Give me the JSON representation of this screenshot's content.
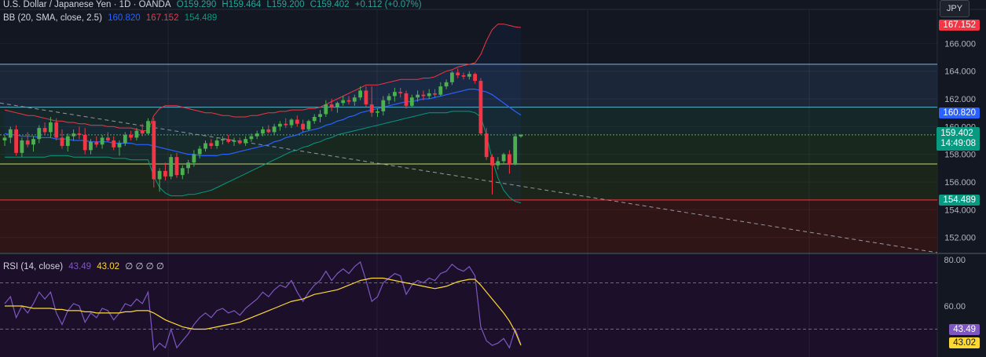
{
  "header": {
    "symbol": "U.S. Dollar / Japanese Yen · 1D · OANDA",
    "open": "O159.290",
    "high": "H159.464",
    "low": "L159.200",
    "close": "C159.402",
    "change": "+0.112 (+0.07%)"
  },
  "bb_legend": {
    "label": "BB (20, SMA, close, 2.5)",
    "basis": "160.820",
    "upper": "167.152",
    "lower": "154.489"
  },
  "rsi_legend": {
    "label": "RSI (14, close)",
    "rsi": "43.49",
    "ma": "43.02",
    "extras": "∅ ∅ ∅ ∅"
  },
  "currency_button": "JPY",
  "price_badges": {
    "upper": "167.152",
    "basis": "160.820",
    "last": "159.402",
    "countdown": "14:49:08",
    "lower": "154.489",
    "rsi": "43.49",
    "rsi_ma": "43.02"
  },
  "colors": {
    "background": "#131722",
    "up": "#26a69a",
    "candle_up": "#4caf50",
    "candle_down": "#f23645",
    "bb_upper": "#f23645",
    "bb_basis": "#2962ff",
    "bb_lower": "#089981",
    "rsi": "#7e57c2",
    "rsi_ma": "#fdd835"
  },
  "chart_data": [
    {
      "type": "candlestick",
      "title": "U.S. Dollar / Japanese Yen",
      "ylim": [
        150.9,
        168.4
      ],
      "y_ticks": [
        "166.000",
        "164.000",
        "162.000",
        "160.000",
        "158.000",
        "156.000",
        "154.000",
        "152.000"
      ],
      "horizontal_levels": [
        164.5,
        161.4,
        159.4,
        157.3,
        154.7
      ],
      "candles": [
        [
          159.0,
          159.4,
          158.6,
          159.2
        ],
        [
          159.2,
          160.0,
          158.8,
          159.8
        ],
        [
          159.8,
          160.1,
          157.9,
          158.1
        ],
        [
          158.1,
          159.2,
          157.8,
          159.0
        ],
        [
          159.0,
          159.6,
          158.5,
          158.7
        ],
        [
          158.7,
          159.3,
          158.2,
          159.1
        ],
        [
          159.1,
          160.1,
          158.8,
          159.9
        ],
        [
          159.9,
          160.3,
          159.4,
          159.6
        ],
        [
          159.6,
          160.7,
          159.2,
          160.3
        ],
        [
          160.3,
          160.6,
          159.0,
          159.2
        ],
        [
          159.2,
          159.8,
          158.4,
          158.6
        ],
        [
          158.6,
          159.5,
          158.2,
          159.3
        ],
        [
          159.3,
          159.8,
          159.0,
          159.5
        ],
        [
          159.5,
          160.0,
          159.1,
          159.4
        ],
        [
          159.4,
          159.9,
          158.0,
          158.3
        ],
        [
          158.3,
          159.1,
          158.0,
          158.9
        ],
        [
          158.9,
          159.3,
          158.5,
          158.7
        ],
        [
          158.7,
          159.4,
          158.4,
          159.2
        ],
        [
          159.2,
          159.6,
          158.9,
          159.0
        ],
        [
          159.0,
          159.3,
          158.3,
          158.5
        ],
        [
          158.5,
          159.0,
          157.9,
          158.8
        ],
        [
          158.8,
          159.6,
          158.6,
          159.4
        ],
        [
          159.4,
          159.7,
          159.0,
          159.2
        ],
        [
          159.2,
          159.9,
          159.0,
          159.7
        ],
        [
          159.7,
          160.2,
          159.3,
          159.5
        ],
        [
          159.5,
          160.6,
          159.4,
          160.4
        ],
        [
          160.4,
          160.6,
          155.6,
          156.2
        ],
        [
          156.2,
          157.0,
          155.3,
          156.8
        ],
        [
          156.8,
          157.4,
          156.1,
          156.4
        ],
        [
          156.4,
          158.0,
          156.2,
          157.8
        ],
        [
          157.8,
          158.1,
          156.3,
          156.5
        ],
        [
          156.5,
          157.2,
          156.2,
          157.0
        ],
        [
          157.0,
          157.6,
          156.6,
          157.4
        ],
        [
          157.4,
          158.3,
          157.1,
          158.0
        ],
        [
          158.0,
          158.6,
          157.7,
          158.4
        ],
        [
          158.4,
          159.0,
          158.2,
          158.8
        ],
        [
          158.8,
          159.1,
          158.4,
          158.6
        ],
        [
          158.6,
          159.2,
          158.4,
          159.0
        ],
        [
          159.0,
          159.3,
          158.7,
          159.1
        ],
        [
          159.1,
          159.4,
          158.8,
          158.9
        ],
        [
          158.9,
          159.2,
          158.6,
          159.0
        ],
        [
          159.0,
          159.2,
          158.7,
          158.8
        ],
        [
          158.8,
          159.3,
          158.6,
          159.1
        ],
        [
          159.1,
          159.5,
          158.9,
          159.3
        ],
        [
          159.3,
          159.7,
          159.1,
          159.5
        ],
        [
          159.5,
          160.0,
          159.3,
          159.8
        ],
        [
          159.8,
          160.1,
          159.5,
          159.6
        ],
        [
          159.6,
          160.2,
          159.4,
          160.0
        ],
        [
          160.0,
          160.4,
          159.7,
          160.2
        ],
        [
          160.2,
          160.6,
          159.9,
          160.1
        ],
        [
          160.1,
          160.6,
          159.9,
          160.5
        ],
        [
          160.5,
          160.8,
          160.0,
          160.2
        ],
        [
          160.2,
          160.5,
          159.6,
          159.8
        ],
        [
          159.8,
          160.5,
          159.7,
          160.4
        ],
        [
          160.4,
          160.9,
          160.2,
          160.7
        ],
        [
          160.7,
          161.2,
          160.3,
          160.9
        ],
        [
          160.9,
          161.9,
          160.7,
          161.6
        ],
        [
          161.6,
          162.0,
          161.1,
          161.4
        ],
        [
          161.4,
          161.8,
          161.0,
          161.7
        ],
        [
          161.7,
          162.2,
          161.5,
          161.9
        ],
        [
          161.9,
          162.2,
          161.6,
          161.8
        ],
        [
          161.8,
          162.3,
          161.5,
          162.1
        ],
        [
          162.1,
          162.9,
          161.9,
          162.6
        ],
        [
          162.6,
          162.9,
          161.4,
          161.6
        ],
        [
          161.6,
          162.9,
          160.7,
          161.0
        ],
        [
          161.0,
          161.3,
          160.7,
          161.1
        ],
        [
          161.1,
          162.2,
          160.8,
          161.9
        ],
        [
          161.9,
          162.4,
          161.6,
          162.2
        ],
        [
          162.2,
          162.8,
          161.8,
          162.5
        ],
        [
          162.5,
          162.8,
          162.1,
          162.4
        ],
        [
          162.4,
          162.6,
          161.3,
          161.5
        ],
        [
          161.5,
          162.3,
          161.4,
          162.1
        ],
        [
          162.1,
          162.6,
          161.8,
          162.3
        ],
        [
          162.3,
          162.6,
          161.9,
          162.2
        ],
        [
          162.2,
          162.7,
          162.0,
          162.4
        ],
        [
          162.4,
          162.7,
          162.1,
          162.3
        ],
        [
          162.3,
          163.2,
          162.2,
          162.9
        ],
        [
          162.9,
          163.4,
          162.7,
          163.2
        ],
        [
          163.2,
          164.0,
          163.0,
          163.9
        ],
        [
          163.9,
          164.2,
          163.5,
          163.7
        ],
        [
          163.7,
          163.9,
          163.4,
          163.6
        ],
        [
          163.6,
          164.0,
          163.4,
          163.8
        ],
        [
          163.8,
          163.9,
          163.1,
          163.3
        ],
        [
          163.3,
          163.5,
          159.4,
          159.5
        ],
        [
          159.5,
          159.9,
          157.6,
          157.8
        ],
        [
          157.8,
          158.0,
          155.1,
          157.2
        ],
        [
          157.2,
          157.8,
          156.9,
          157.5
        ],
        [
          157.5,
          158.1,
          157.3,
          158.0
        ],
        [
          158.0,
          158.3,
          156.6,
          157.3
        ],
        [
          157.3,
          159.5,
          157.2,
          159.3
        ],
        [
          159.29,
          159.464,
          159.2,
          159.402
        ]
      ],
      "bb_upper": [
        161.2,
        161.1,
        161.0,
        160.9,
        160.8,
        160.8,
        160.7,
        160.6,
        160.5,
        160.4,
        160.4,
        160.3,
        160.3,
        160.2,
        160.2,
        160.1,
        160.1,
        160.1,
        160.0,
        160.0,
        159.9,
        159.9,
        159.9,
        159.8,
        159.7,
        159.7,
        160.8,
        161.3,
        161.5,
        161.5,
        161.5,
        161.4,
        161.3,
        161.2,
        161.1,
        161.0,
        161.0,
        160.9,
        160.8,
        160.8,
        160.7,
        160.7,
        160.7,
        160.8,
        160.8,
        160.9,
        161.0,
        161.0,
        161.1,
        161.1,
        161.2,
        161.2,
        161.2,
        161.3,
        161.3,
        161.4,
        161.6,
        161.8,
        162.0,
        162.2,
        162.4,
        162.6,
        162.8,
        163.0,
        163.0,
        163.0,
        163.1,
        163.2,
        163.3,
        163.4,
        163.4,
        163.4,
        163.4,
        163.5,
        163.5,
        163.6,
        163.8,
        164.0,
        164.1,
        164.3,
        164.4,
        164.5,
        164.6,
        165.2,
        166.2,
        167.0,
        167.4,
        167.4,
        167.3,
        167.2,
        167.152
      ],
      "bb_basis": [
        159.5,
        159.4,
        159.4,
        159.3,
        159.3,
        159.3,
        159.2,
        159.2,
        159.2,
        159.1,
        159.1,
        159.1,
        159.0,
        159.0,
        159.0,
        158.9,
        158.9,
        158.9,
        158.9,
        158.8,
        158.8,
        158.8,
        158.8,
        158.7,
        158.7,
        158.7,
        158.6,
        158.5,
        158.4,
        158.3,
        158.2,
        158.1,
        158.0,
        158.0,
        157.9,
        157.9,
        157.9,
        157.9,
        158.0,
        158.0,
        158.1,
        158.2,
        158.3,
        158.4,
        158.5,
        158.6,
        158.7,
        158.9,
        159.0,
        159.2,
        159.3,
        159.4,
        159.6,
        159.7,
        159.8,
        159.9,
        160.1,
        160.2,
        160.4,
        160.5,
        160.7,
        160.8,
        161.0,
        161.1,
        161.2,
        161.3,
        161.4,
        161.5,
        161.6,
        161.7,
        161.8,
        161.8,
        161.9,
        162.0,
        162.0,
        162.1,
        162.2,
        162.3,
        162.4,
        162.5,
        162.6,
        162.7,
        162.7,
        162.6,
        162.5,
        162.3,
        162.0,
        161.7,
        161.4,
        161.1,
        160.82
      ],
      "bb_lower": [
        157.8,
        157.8,
        157.8,
        157.8,
        157.8,
        157.8,
        157.8,
        157.8,
        157.9,
        157.9,
        157.9,
        157.9,
        157.8,
        157.8,
        157.8,
        157.8,
        157.8,
        157.8,
        157.8,
        157.7,
        157.7,
        157.7,
        157.6,
        157.6,
        157.6,
        157.6,
        156.4,
        155.6,
        155.2,
        155.0,
        155.0,
        155.0,
        155.1,
        155.1,
        155.2,
        155.3,
        155.4,
        155.6,
        155.8,
        156.0,
        156.2,
        156.4,
        156.6,
        156.8,
        157.0,
        157.2,
        157.4,
        157.6,
        157.8,
        158.0,
        158.2,
        158.3,
        158.5,
        158.6,
        158.8,
        158.9,
        159.1,
        159.2,
        159.4,
        159.5,
        159.6,
        159.7,
        159.8,
        159.9,
        160.0,
        160.1,
        160.2,
        160.3,
        160.4,
        160.5,
        160.6,
        160.7,
        160.8,
        160.9,
        161.0,
        161.0,
        161.0,
        161.0,
        161.1,
        161.1,
        161.1,
        161.1,
        161.0,
        160.7,
        159.4,
        157.6,
        156.3,
        155.4,
        154.9,
        154.6,
        154.489
      ]
    },
    {
      "type": "line",
      "title": "RSI (14, close)",
      "ylim": [
        38,
        82
      ],
      "y_ticks": [
        "80.00",
        "60.00"
      ],
      "levels": [
        70,
        50
      ],
      "series": [
        {
          "name": "RSI",
          "values": [
            61,
            64,
            55,
            60,
            57,
            61,
            66,
            63,
            66,
            57,
            52,
            58,
            61,
            60,
            53,
            57,
            55,
            59,
            58,
            54,
            57,
            61,
            60,
            63,
            61,
            66,
            41,
            44,
            42,
            50,
            42,
            45,
            48,
            52,
            55,
            57,
            55,
            58,
            59,
            57,
            58,
            56,
            59,
            61,
            63,
            66,
            64,
            67,
            69,
            68,
            71,
            66,
            62,
            66,
            69,
            71,
            75,
            71,
            74,
            76,
            74,
            77,
            79,
            71,
            62,
            64,
            70,
            72,
            74,
            73,
            65,
            69,
            71,
            70,
            72,
            71,
            74,
            75,
            78,
            76,
            75,
            77,
            73,
            51,
            45,
            43,
            44,
            46,
            42,
            50,
            43.49
          ]
        },
        {
          "name": "RSI MA",
          "values": [
            60,
            60,
            60,
            60,
            59.5,
            59,
            59,
            59,
            59,
            58.5,
            58.5,
            58,
            58,
            58,
            57.5,
            57.5,
            57,
            57,
            57,
            57,
            57,
            57.5,
            57.5,
            58,
            58,
            58,
            57,
            55.5,
            54,
            53,
            52,
            51,
            50.5,
            50,
            50,
            50,
            50.5,
            51,
            51.5,
            52,
            52.5,
            53,
            54,
            55,
            56,
            57,
            58,
            59,
            60,
            61,
            62,
            62.5,
            63,
            64,
            65,
            65.5,
            66,
            66.5,
            67,
            68,
            69,
            70,
            71,
            71.5,
            72,
            72,
            72,
            71.5,
            71,
            70.5,
            70,
            69.5,
            69,
            68.5,
            68,
            67.5,
            68,
            68.5,
            69.5,
            70.5,
            71,
            71.5,
            71.5,
            69,
            66,
            63,
            60,
            57,
            53.5,
            49,
            43.02
          ]
        }
      ]
    }
  ]
}
